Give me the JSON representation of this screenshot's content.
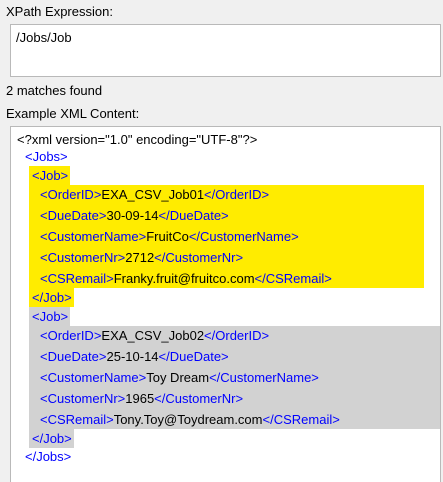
{
  "xpath": {
    "label": "XPath Expression:",
    "value": "/Jobs/Job"
  },
  "status": {
    "matches": "2 matches found"
  },
  "example": {
    "label": "Example XML Content:"
  },
  "xml": {
    "declaration": "<?xml version=\"1.0\" encoding=\"UTF-8\"?>",
    "root_open": "<Jobs>",
    "root_close": "</Jobs>",
    "job_open": "<Job>",
    "job_close": "</Job>",
    "jobs": [
      {
        "order_open": "<OrderID>",
        "order_val": "EXA_CSV_Job01",
        "order_close": "</OrderID>",
        "due_open": "<DueDate>",
        "due_val": "30-09-14",
        "due_close": "</DueDate>",
        "cust_open": "<CustomerName>",
        "cust_val": "FruitCo",
        "cust_close": "</CustomerName>",
        "nr_open": "<CustomerNr>",
        "nr_val": "2712",
        "nr_close": "</CustomerNr>",
        "mail_open": "<CSRemail>",
        "mail_val": "Franky.fruit@fruitco.com",
        "mail_close": "</CSRemail>"
      },
      {
        "order_open": "<OrderID>",
        "order_val": "EXA_CSV_Job02",
        "order_close": "</OrderID>",
        "due_open": "<DueDate>",
        "due_val": "25-10-14",
        "due_close": "</DueDate>",
        "cust_open": "<CustomerName>",
        "cust_val": "Toy Dream",
        "cust_close": "</CustomerName>",
        "nr_open": "<CustomerNr>",
        "nr_val": "1965",
        "nr_close": "</CustomerNr>",
        "mail_open": "<CSRemail>",
        "mail_val": "Tony.Toy@Toydream.com",
        "mail_close": "</CSRemail>"
      }
    ]
  },
  "colors": {
    "match_1_highlight": "#ffec00",
    "match_2_highlight": "#d2d2d2",
    "tag": "#0000ff",
    "text": "#000000"
  }
}
